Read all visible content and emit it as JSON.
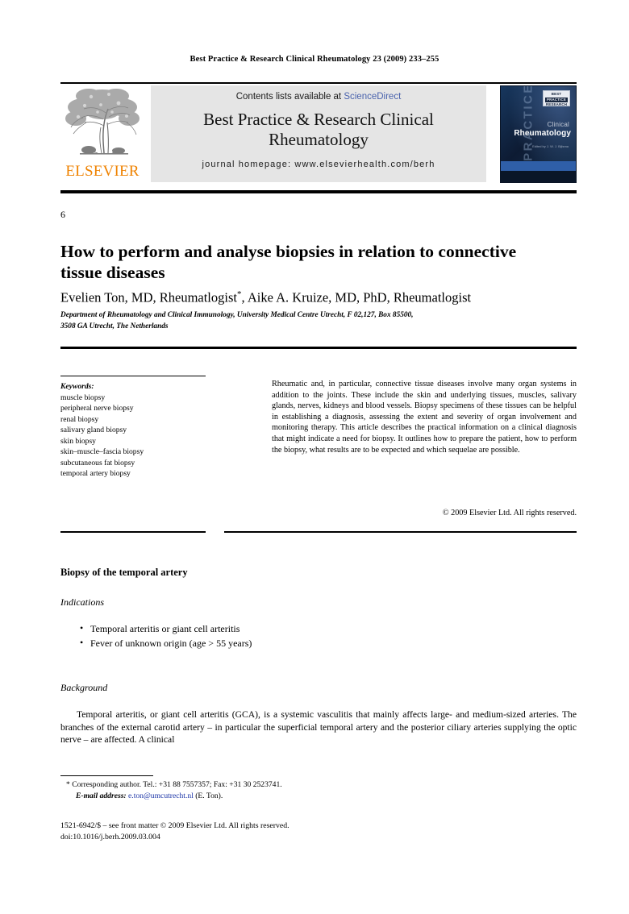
{
  "running_head": "Best Practice & Research Clinical Rheumatology 23 (2009) 233–255",
  "masthead": {
    "publisher_wordmark": "ELSEVIER",
    "contents_prefix": "Contents lists available at ",
    "contents_link": "ScienceDirect",
    "journal_title_line1": "Best Practice & Research Clinical",
    "journal_title_line2": "Rheumatology",
    "homepage": "journal homepage: www.elsevierhealth.com/berh",
    "accent_orange": "#ef8200",
    "link_blue": "#4a63ad",
    "box_gray": "#e5e5e5",
    "cover": {
      "vertical_text": "PRACTICE",
      "badge_line1": "BEST",
      "badge_line2": "PRACTICE",
      "badge_line3": "RESEARCH",
      "subtitle": "Clinical",
      "title": "Rheumatology",
      "editor": "Edited by\nJ. W. J. Bijlsma",
      "band_blue": "#2f5fa8",
      "background_navy": "#0d1b33"
    }
  },
  "article": {
    "chapter_number": "6",
    "title": "How to perform and analyse biopsies in relation to connective tissue diseases",
    "authors": "Evelien Ton, MD, Rheumatlogist",
    "author_marker": "*",
    "authors_rest": ", Aike A. Kruize, MD, PhD, Rheumatlogist",
    "affiliation_line1": "Department of Rheumatology and Clinical Immunology, University Medical Centre Utrecht, F 02,127, Box 85500,",
    "affiliation_line2": "3508 GA Utrecht, The Netherlands"
  },
  "keywords": {
    "heading": "Keywords:",
    "items": [
      "muscle biopsy",
      "peripheral nerve biopsy",
      "renal biopsy",
      "salivary gland biopsy",
      "skin biopsy",
      "skin–muscle–fascia biopsy",
      "subcutaneous fat biopsy",
      "temporal artery biopsy"
    ]
  },
  "abstract": {
    "text": "Rheumatic and, in particular, connective tissue diseases involve many organ systems in addition to the joints. These include the skin and underlying tissues, muscles, salivary glands, nerves, kidneys and blood vessels. Biopsy specimens of these tissues can be helpful in establishing a diagnosis, assessing the extent and severity of organ involvement and monitoring therapy. This article describes the practical information on a clinical diagnosis that might indicate a need for biopsy. It outlines how to prepare the patient, how to perform the biopsy, what results are to be expected and which sequelae are possible.",
    "copyright": "© 2009 Elsevier Ltd. All rights reserved."
  },
  "body": {
    "section_heading": "Biopsy of the temporal artery",
    "indications_heading": "Indications",
    "indications": [
      "Temporal arteritis or giant cell arteritis",
      "Fever of unknown origin (age > 55 years)"
    ],
    "background_heading": "Background",
    "background_paragraph": "Temporal arteritis, or giant cell arteritis (GCA), is a systemic vasculitis that mainly affects large- and medium-sized arteries. The branches of the external carotid artery – in particular the superficial temporal artery and the posterior ciliary arteries supplying the optic nerve – are affected. A clinical"
  },
  "footnotes": {
    "corresponding_marker": "*",
    "corresponding_text": "Corresponding author. Tel.: +31 88 7557357; Fax: +31 30 2523741.",
    "email_label": "E-mail address:",
    "email": "e.ton@umcutrecht.nl",
    "email_suffix": "(E. Ton).",
    "email_color": "#1d36a8"
  },
  "imprint": {
    "line1": "1521-6942/$ – see front matter © 2009 Elsevier Ltd. All rights reserved.",
    "line2": "doi:10.1016/j.berh.2009.03.004"
  }
}
